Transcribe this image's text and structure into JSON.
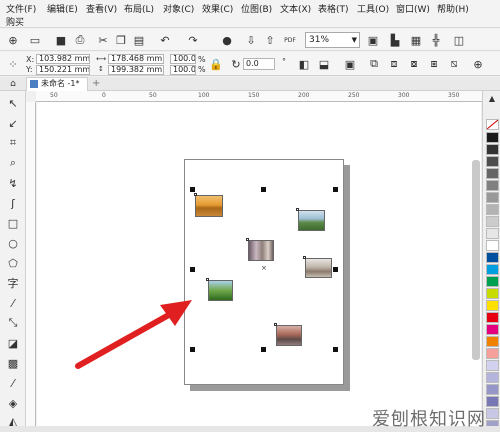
{
  "menubar": {
    "items": [
      "文件(F)",
      "编辑(E)",
      "查看(V)",
      "布局(L)",
      "对象(C)",
      "效果(C)",
      "位图(B)",
      "文本(X)",
      "表格(T)",
      "工具(O)",
      "窗口(W)",
      "帮助(H)"
    ],
    "item_buy": "购买"
  },
  "toolbar": {
    "zoom": "31%",
    "pdf_label": "PDF"
  },
  "propbar": {
    "x_label": "X:",
    "x_value": "103.982 mm",
    "y_label": "Y:",
    "y_value": "150.221 mm",
    "w_value": "178.468 mm",
    "h_value": "199.382 mm",
    "scale_w": "100.0",
    "scale_h": "100.0",
    "pct": "%",
    "rotation": "0.0",
    "degree": "°"
  },
  "tabs": {
    "document": "未命名 -1*",
    "add": "+"
  },
  "ruler": {
    "ticks": [
      "50",
      "0",
      "50",
      "100",
      "150",
      "200",
      "250",
      "300",
      "350"
    ]
  },
  "palette": {
    "colors": [
      "#1a1a1a",
      "#333333",
      "#4d4d4d",
      "#666666",
      "#808080",
      "#999999",
      "#b3b3b3",
      "#cccccc",
      "#e6e6e6",
      "#ffffff",
      "#0050a0",
      "#00a0e0",
      "#00a050",
      "#c8dc00",
      "#ffe000",
      "#e60012",
      "#e4007f",
      "#f08200",
      "#f5a09a",
      "#d2d2f0",
      "#b4b4dc",
      "#9696c8",
      "#7878b4",
      "#c8c8e6",
      "#a0a0c8"
    ]
  },
  "watermark": "爱刨根知识网"
}
